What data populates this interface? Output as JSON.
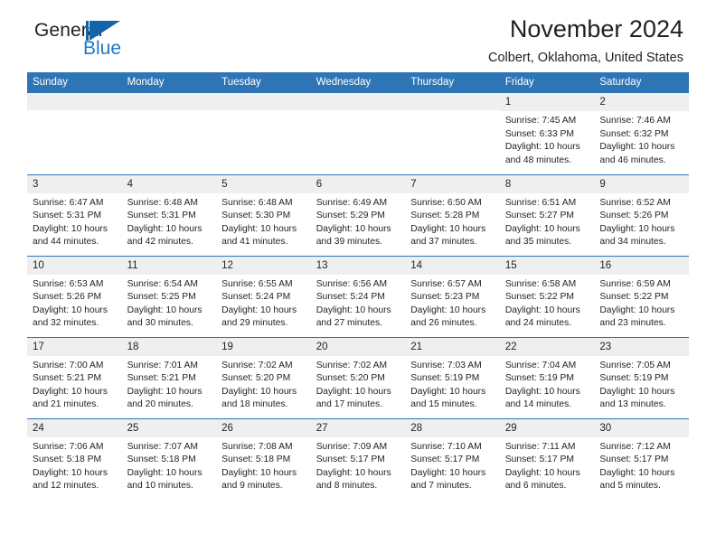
{
  "brand": {
    "name_primary": "General",
    "name_secondary": "Blue",
    "triangle_color": "#1464aa",
    "secondary_color": "#1e78c8"
  },
  "header": {
    "title": "November 2024",
    "subtitle": "Colbert, Oklahoma, United States"
  },
  "theme": {
    "header_band": "#2e75b6",
    "daynum_band": "#efefef",
    "text": "#231f20"
  },
  "weekdays": [
    "Sunday",
    "Monday",
    "Tuesday",
    "Wednesday",
    "Thursday",
    "Friday",
    "Saturday"
  ],
  "labels": {
    "sunrise_prefix": "Sunrise:",
    "sunset_prefix": "Sunset:",
    "daylight_prefix": "Daylight:"
  },
  "weeks": [
    [
      {
        "day": "",
        "sunrise": "",
        "sunset": "",
        "daylight": ""
      },
      {
        "day": "",
        "sunrise": "",
        "sunset": "",
        "daylight": ""
      },
      {
        "day": "",
        "sunrise": "",
        "sunset": "",
        "daylight": ""
      },
      {
        "day": "",
        "sunrise": "",
        "sunset": "",
        "daylight": ""
      },
      {
        "day": "",
        "sunrise": "",
        "sunset": "",
        "daylight": ""
      },
      {
        "day": "1",
        "sunrise": "Sunrise: 7:45 AM",
        "sunset": "Sunset: 6:33 PM",
        "daylight": "Daylight: 10 hours and 48 minutes."
      },
      {
        "day": "2",
        "sunrise": "Sunrise: 7:46 AM",
        "sunset": "Sunset: 6:32 PM",
        "daylight": "Daylight: 10 hours and 46 minutes."
      }
    ],
    [
      {
        "day": "3",
        "sunrise": "Sunrise: 6:47 AM",
        "sunset": "Sunset: 5:31 PM",
        "daylight": "Daylight: 10 hours and 44 minutes."
      },
      {
        "day": "4",
        "sunrise": "Sunrise: 6:48 AM",
        "sunset": "Sunset: 5:31 PM",
        "daylight": "Daylight: 10 hours and 42 minutes."
      },
      {
        "day": "5",
        "sunrise": "Sunrise: 6:48 AM",
        "sunset": "Sunset: 5:30 PM",
        "daylight": "Daylight: 10 hours and 41 minutes."
      },
      {
        "day": "6",
        "sunrise": "Sunrise: 6:49 AM",
        "sunset": "Sunset: 5:29 PM",
        "daylight": "Daylight: 10 hours and 39 minutes."
      },
      {
        "day": "7",
        "sunrise": "Sunrise: 6:50 AM",
        "sunset": "Sunset: 5:28 PM",
        "daylight": "Daylight: 10 hours and 37 minutes."
      },
      {
        "day": "8",
        "sunrise": "Sunrise: 6:51 AM",
        "sunset": "Sunset: 5:27 PM",
        "daylight": "Daylight: 10 hours and 35 minutes."
      },
      {
        "day": "9",
        "sunrise": "Sunrise: 6:52 AM",
        "sunset": "Sunset: 5:26 PM",
        "daylight": "Daylight: 10 hours and 34 minutes."
      }
    ],
    [
      {
        "day": "10",
        "sunrise": "Sunrise: 6:53 AM",
        "sunset": "Sunset: 5:26 PM",
        "daylight": "Daylight: 10 hours and 32 minutes."
      },
      {
        "day": "11",
        "sunrise": "Sunrise: 6:54 AM",
        "sunset": "Sunset: 5:25 PM",
        "daylight": "Daylight: 10 hours and 30 minutes."
      },
      {
        "day": "12",
        "sunrise": "Sunrise: 6:55 AM",
        "sunset": "Sunset: 5:24 PM",
        "daylight": "Daylight: 10 hours and 29 minutes."
      },
      {
        "day": "13",
        "sunrise": "Sunrise: 6:56 AM",
        "sunset": "Sunset: 5:24 PM",
        "daylight": "Daylight: 10 hours and 27 minutes."
      },
      {
        "day": "14",
        "sunrise": "Sunrise: 6:57 AM",
        "sunset": "Sunset: 5:23 PM",
        "daylight": "Daylight: 10 hours and 26 minutes."
      },
      {
        "day": "15",
        "sunrise": "Sunrise: 6:58 AM",
        "sunset": "Sunset: 5:22 PM",
        "daylight": "Daylight: 10 hours and 24 minutes."
      },
      {
        "day": "16",
        "sunrise": "Sunrise: 6:59 AM",
        "sunset": "Sunset: 5:22 PM",
        "daylight": "Daylight: 10 hours and 23 minutes."
      }
    ],
    [
      {
        "day": "17",
        "sunrise": "Sunrise: 7:00 AM",
        "sunset": "Sunset: 5:21 PM",
        "daylight": "Daylight: 10 hours and 21 minutes."
      },
      {
        "day": "18",
        "sunrise": "Sunrise: 7:01 AM",
        "sunset": "Sunset: 5:21 PM",
        "daylight": "Daylight: 10 hours and 20 minutes."
      },
      {
        "day": "19",
        "sunrise": "Sunrise: 7:02 AM",
        "sunset": "Sunset: 5:20 PM",
        "daylight": "Daylight: 10 hours and 18 minutes."
      },
      {
        "day": "20",
        "sunrise": "Sunrise: 7:02 AM",
        "sunset": "Sunset: 5:20 PM",
        "daylight": "Daylight: 10 hours and 17 minutes."
      },
      {
        "day": "21",
        "sunrise": "Sunrise: 7:03 AM",
        "sunset": "Sunset: 5:19 PM",
        "daylight": "Daylight: 10 hours and 15 minutes."
      },
      {
        "day": "22",
        "sunrise": "Sunrise: 7:04 AM",
        "sunset": "Sunset: 5:19 PM",
        "daylight": "Daylight: 10 hours and 14 minutes."
      },
      {
        "day": "23",
        "sunrise": "Sunrise: 7:05 AM",
        "sunset": "Sunset: 5:19 PM",
        "daylight": "Daylight: 10 hours and 13 minutes."
      }
    ],
    [
      {
        "day": "24",
        "sunrise": "Sunrise: 7:06 AM",
        "sunset": "Sunset: 5:18 PM",
        "daylight": "Daylight: 10 hours and 12 minutes."
      },
      {
        "day": "25",
        "sunrise": "Sunrise: 7:07 AM",
        "sunset": "Sunset: 5:18 PM",
        "daylight": "Daylight: 10 hours and 10 minutes."
      },
      {
        "day": "26",
        "sunrise": "Sunrise: 7:08 AM",
        "sunset": "Sunset: 5:18 PM",
        "daylight": "Daylight: 10 hours and 9 minutes."
      },
      {
        "day": "27",
        "sunrise": "Sunrise: 7:09 AM",
        "sunset": "Sunset: 5:17 PM",
        "daylight": "Daylight: 10 hours and 8 minutes."
      },
      {
        "day": "28",
        "sunrise": "Sunrise: 7:10 AM",
        "sunset": "Sunset: 5:17 PM",
        "daylight": "Daylight: 10 hours and 7 minutes."
      },
      {
        "day": "29",
        "sunrise": "Sunrise: 7:11 AM",
        "sunset": "Sunset: 5:17 PM",
        "daylight": "Daylight: 10 hours and 6 minutes."
      },
      {
        "day": "30",
        "sunrise": "Sunrise: 7:12 AM",
        "sunset": "Sunset: 5:17 PM",
        "daylight": "Daylight: 10 hours and 5 minutes."
      }
    ]
  ]
}
